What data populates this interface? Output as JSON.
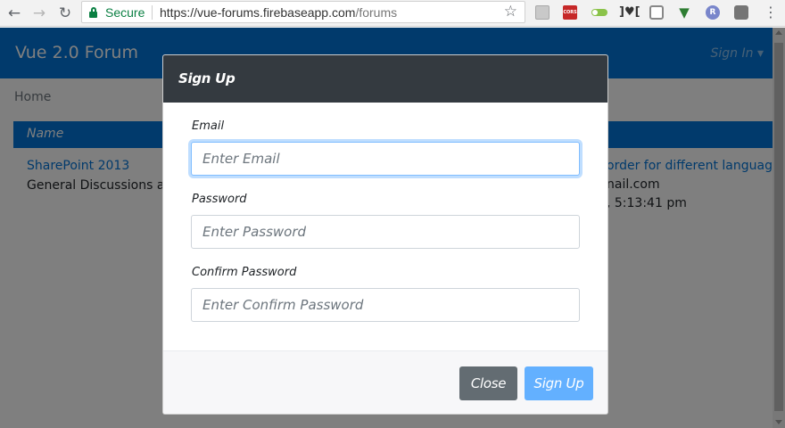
{
  "browser": {
    "security_label": "Secure",
    "url_main": "https://vue-forums.firebaseapp.com",
    "url_path": "/forums",
    "icons": [
      "back-arrow-icon",
      "forward-arrow-icon",
      "reload-icon",
      "lock-icon",
      "star-icon",
      "menu-dots-icon"
    ],
    "extensions": {
      "cors_label": "CORS",
      "react_label": "R"
    }
  },
  "site": {
    "brand": "Vue 2.0 Forum",
    "signin_label": "Sign In",
    "breadcrumb": "Home",
    "table": {
      "columns": [
        "Name"
      ]
    },
    "forum": {
      "name": "SharePoint 2013",
      "description": "General Discussions and Q"
    },
    "latest_post": {
      "title": "order for different language",
      "author": "nail.com",
      "time": ", 5:13:41 pm"
    }
  },
  "modal": {
    "title": "Sign Up",
    "fields": [
      {
        "label": "Email",
        "placeholder": "Enter Email",
        "value": ""
      },
      {
        "label": "Password",
        "placeholder": "Enter Password",
        "value": ""
      },
      {
        "label": "Confirm Password",
        "placeholder": "Enter Confirm Password",
        "value": ""
      }
    ],
    "buttons": {
      "close": "Close",
      "submit": "Sign Up"
    }
  },
  "colors": {
    "primary": "#0275d8",
    "modal_header": "#343a40",
    "secondary_button": "#636c72",
    "primary_button_disabled": "#63b0ff",
    "secure_green": "#0b8043"
  }
}
